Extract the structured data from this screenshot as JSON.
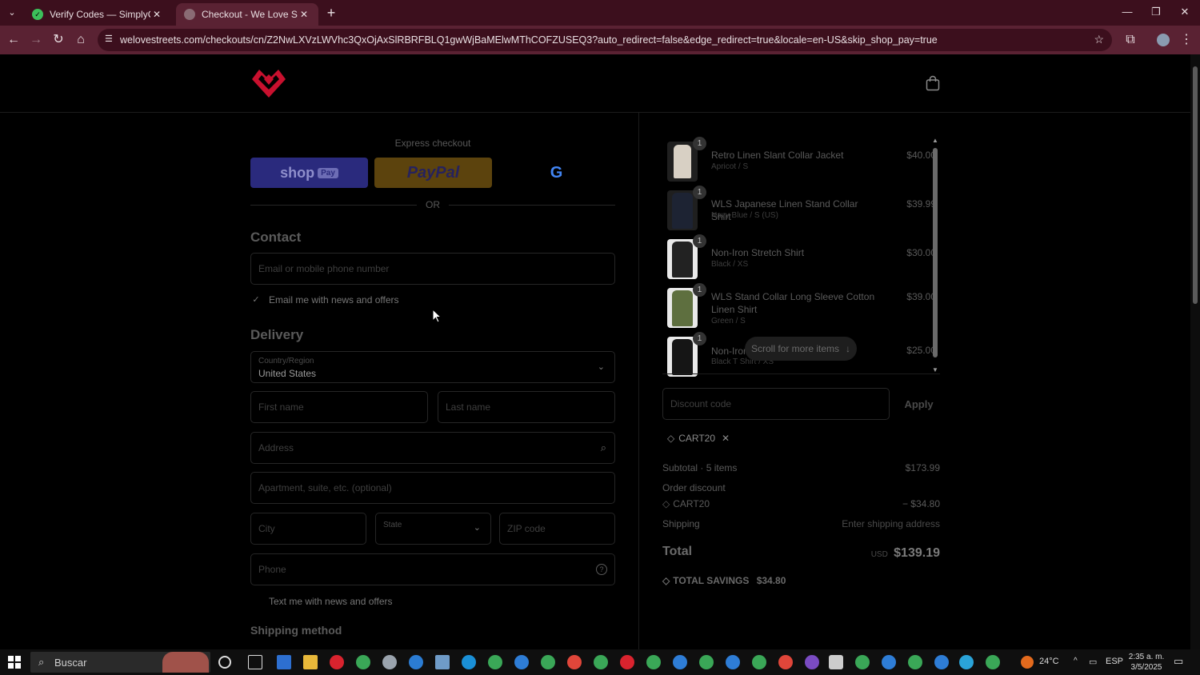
{
  "browser": {
    "tabs": [
      {
        "title": "Verify Codes — SimplyCodes",
        "active": false
      },
      {
        "title": "Checkout - We Love Street",
        "active": true
      }
    ],
    "url": "welovestreets.com/checkouts/cn/Z2NwLXVzLWVhc3QxOjAxSlRBRFBLQ1gwWjBaMElwMThCOFZUSEQ3?auto_redirect=false&edge_redirect=true&locale=en-US&skip_shop_pay=true"
  },
  "checkout": {
    "express_title": "Express checkout",
    "shop_label": "shop",
    "shop_pay_badge": "Pay",
    "paypal_label": "PayPal",
    "google_label": "G",
    "or_label": "OR",
    "contact_heading": "Contact",
    "email_placeholder": "Email or mobile phone number",
    "email_news_label": "Email me with news and offers",
    "delivery_heading": "Delivery",
    "country_label": "Country/Region",
    "country_value": "United States",
    "first_name_placeholder": "First name",
    "last_name_placeholder": "Last name",
    "address_placeholder": "Address",
    "apartment_placeholder": "Apartment, suite, etc. (optional)",
    "city_placeholder": "City",
    "state_label": "State",
    "zip_placeholder": "ZIP code",
    "phone_placeholder": "Phone",
    "text_news_label": "Text me with news and offers",
    "shipping_method_heading": "Shipping method"
  },
  "cart": {
    "items": [
      {
        "name": "Retro Linen Slant Collar Jacket",
        "variant": "Apricot / S",
        "price": "$40.00",
        "qty": "1",
        "thumb_color": "#d8d0c4"
      },
      {
        "name": "WLS Japanese Linen Stand Collar Shirt",
        "variant": "Navy Blue / S (US)",
        "price": "$39.99",
        "qty": "1",
        "thumb_color": "#1d2333"
      },
      {
        "name": "Non-Iron Stretch Shirt",
        "variant": "Black / XS",
        "price": "$30.00",
        "qty": "1",
        "thumb_color": "#222222"
      },
      {
        "name": "WLS Stand Collar Long Sleeve Cotton Linen Shirt",
        "variant": "Green / S",
        "price": "$39.00",
        "qty": "1",
        "thumb_color": "#5e6f3f"
      },
      {
        "name": "Non-Iron",
        "variant": "Black T Shirt / XS",
        "price": "$25.00",
        "qty": "1",
        "thumb_color": "#151515"
      }
    ],
    "scroll_hint": "Scroll for more items",
    "discount_placeholder": "Discount code",
    "apply_label": "Apply",
    "applied_code": "CART20",
    "subtotal_label": "Subtotal · 5 items",
    "subtotal_value": "$173.99",
    "order_discount_label": "Order discount",
    "discount_code_label": "CART20",
    "discount_value": "− $34.80",
    "shipping_label": "Shipping",
    "shipping_value": "Enter shipping address",
    "total_label": "Total",
    "currency": "USD",
    "total_value": "$139.19",
    "savings_label": "TOTAL SAVINGS",
    "savings_value": "$34.80"
  },
  "taskbar": {
    "search_label": "Buscar",
    "weather": "24°C",
    "language": "ESP",
    "time": "2:35 a. m.",
    "date": "3/5/2025"
  },
  "colors": {
    "tab_bar": "#3c0f1d",
    "toolbar": "#5a2233",
    "brand_red": "#c8102e"
  }
}
